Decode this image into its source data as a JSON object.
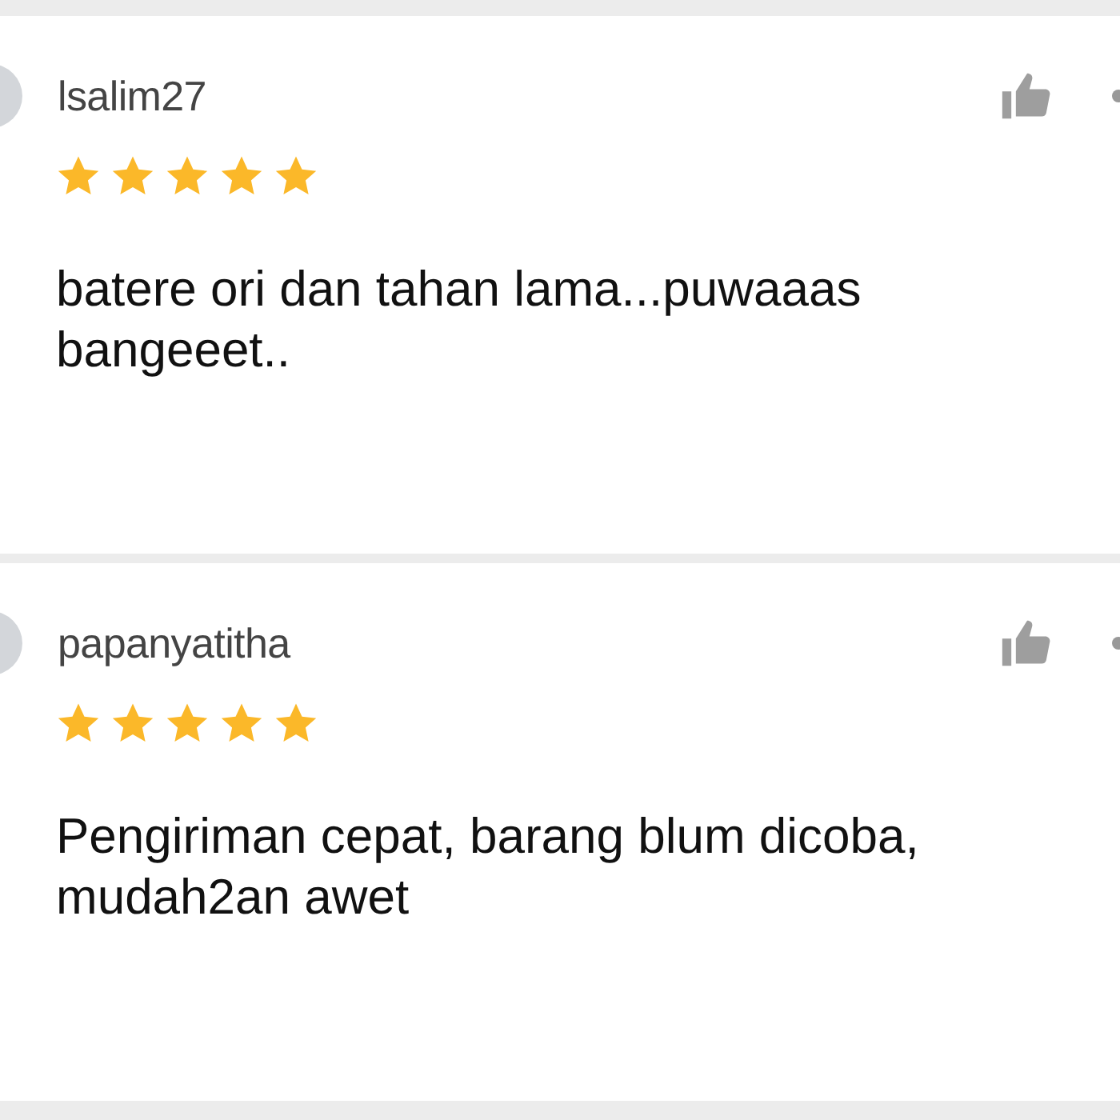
{
  "reviews": [
    {
      "user": "lsalim27",
      "stars": 5,
      "text": "batere ori dan tahan lama...puwaaas bangeeet.."
    },
    {
      "user": "papanyatitha",
      "stars": 5,
      "text": "Pengiriman cepat, barang blum dicoba, mudah2an awet"
    }
  ]
}
